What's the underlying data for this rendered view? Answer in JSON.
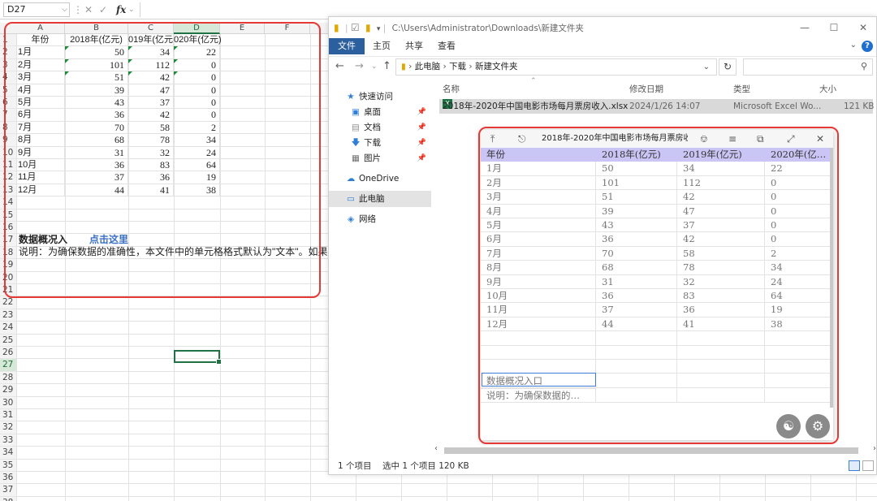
{
  "formula_bar": {
    "name_box": "D27",
    "fx_label": "fx"
  },
  "sheet": {
    "columns": [
      "A",
      "B",
      "C",
      "D",
      "E",
      "F"
    ],
    "header_row": [
      "年份",
      "2018年(亿元)",
      "019年(亿元",
      "020年(亿元)"
    ],
    "rows": [
      [
        "1月",
        "50",
        "34",
        "22"
      ],
      [
        "2月",
        "101",
        "112",
        "0"
      ],
      [
        "3月",
        "51",
        "42",
        "0"
      ],
      [
        "4月",
        "39",
        "47",
        "0"
      ],
      [
        "5月",
        "43",
        "37",
        "0"
      ],
      [
        "6月",
        "36",
        "42",
        "0"
      ],
      [
        "7月",
        "70",
        "58",
        "2"
      ],
      [
        "8月",
        "68",
        "78",
        "34"
      ],
      [
        "9月",
        "31",
        "32",
        "24"
      ],
      [
        "10月",
        "36",
        "83",
        "64"
      ],
      [
        "11月",
        "37",
        "36",
        "19"
      ],
      [
        "12月",
        "44",
        "41",
        "38"
      ]
    ],
    "row_numbers": [
      "1",
      "2",
      "3",
      "4",
      "5",
      "6",
      "7",
      "8",
      "9",
      "10",
      "11",
      "12",
      "13",
      "14",
      "15",
      "16",
      "17",
      "18",
      "19",
      "20",
      "21",
      "22",
      "23",
      "24",
      "25",
      "26",
      "27",
      "28",
      "29",
      "30",
      "31",
      "32",
      "33",
      "34",
      "35",
      "36",
      "37",
      "38",
      "39"
    ],
    "overview_label": "数据概况入",
    "click_here": "点击这里",
    "note": "说明：为确保数据的准确性，本文件中的单元格格式默认为\"文本\"。如果需要"
  },
  "explorer": {
    "title_path": "C:\\Users\\Administrator\\Downloads\\新建文件夹",
    "ribbon_tabs": [
      "文件",
      "主页",
      "共享",
      "查看"
    ],
    "breadcrumb": [
      "此电脑",
      "下载",
      "新建文件夹"
    ],
    "nav_items": [
      {
        "label": "快速访问",
        "icon": "star-icon"
      },
      {
        "label": "桌面",
        "icon": "desktop-icon"
      },
      {
        "label": "文档",
        "icon": "document-icon"
      },
      {
        "label": "下载",
        "icon": "download-icon"
      },
      {
        "label": "图片",
        "icon": "picture-icon"
      },
      {
        "label": "OneDrive",
        "icon": "cloud-icon"
      },
      {
        "label": "此电脑",
        "icon": "computer-icon"
      },
      {
        "label": "网络",
        "icon": "network-icon"
      }
    ],
    "columns": [
      "名称",
      "修改日期",
      "类型",
      "大小"
    ],
    "file": {
      "name": "2018年-2020年中国电影市场每月票房收入.xlsx",
      "modified": "2024/1/26 14:07",
      "type": "Microsoft Excel Wo...",
      "size": "121 KB"
    },
    "status": {
      "count": "1 个项目",
      "selected": "选中 1 个项目  120 KB"
    }
  },
  "preview": {
    "title": "2018年-2020年中国电影市场每月票房收...",
    "header": [
      "年份",
      "2018年(亿元)",
      "2019年(亿元)",
      "2020年(亿…"
    ],
    "rows": [
      [
        "1月",
        "50",
        "34",
        "22"
      ],
      [
        "2月",
        "101",
        "112",
        "0"
      ],
      [
        "3月",
        "51",
        "42",
        "0"
      ],
      [
        "4月",
        "39",
        "47",
        "0"
      ],
      [
        "5月",
        "43",
        "37",
        "0"
      ],
      [
        "6月",
        "36",
        "42",
        "0"
      ],
      [
        "7月",
        "70",
        "58",
        "2"
      ],
      [
        "8月",
        "68",
        "78",
        "34"
      ],
      [
        "9月",
        "31",
        "32",
        "24"
      ],
      [
        "10月",
        "36",
        "83",
        "64"
      ],
      [
        "11月",
        "37",
        "36",
        "19"
      ],
      [
        "12月",
        "44",
        "41",
        "38"
      ]
    ],
    "overview": "数据概况入口",
    "note": "说明：为确保数据的…"
  },
  "colors": {
    "excel_green": "#217346",
    "annotation_red": "#e53935",
    "preview_header": "#c9c6f5",
    "explorer_file_tab": "#2c5f9e"
  }
}
